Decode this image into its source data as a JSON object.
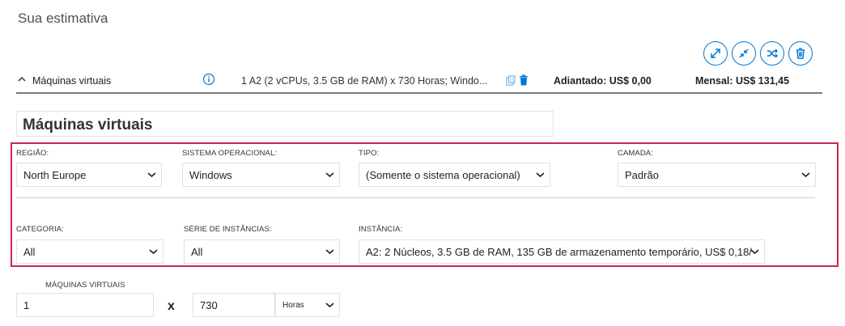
{
  "page_title": "Sua estimativa",
  "actions": [
    "expand-all-icon",
    "collapse-all-icon",
    "shuffle-icon",
    "delete-all-icon"
  ],
  "summary": {
    "name": "Máquinas virtuais",
    "description": "1 A2 (2 vCPUs, 3.5 GB de RAM) x 730 Horas; Windo...",
    "upfront": "Adiantado: US$ 0,00",
    "monthly": "Mensal: US$ 131,45"
  },
  "section_title": "Máquinas virtuais",
  "config": {
    "region": {
      "label": "REGIÃO:",
      "value": "North Europe"
    },
    "os": {
      "label": "SISTEMA OPERACIONAL:",
      "value": "Windows"
    },
    "type": {
      "label": "TIPO:",
      "value": "(Somente o sistema operacional)"
    },
    "tier": {
      "label": "CAMADA:",
      "value": "Padrão"
    },
    "category": {
      "label": "CATEGORIA:",
      "value": "All"
    },
    "series": {
      "label": "SÉRIE DE INSTÂNCIAS:",
      "value": "All"
    },
    "instance": {
      "label": "INSTÂNCIA:",
      "value": "A2: 2 Núcleos, 3.5 GB de RAM, 135 GB de armazenamento temporário, US$ 0,18/"
    }
  },
  "quantity": {
    "label": "MÁQUINAS VIRTUAIS",
    "vm_count": "1",
    "times_symbol": "x",
    "hours": "730",
    "unit": "Horas"
  },
  "colors": {
    "accent": "#0078d4",
    "highlight_border": "#c8294c"
  }
}
